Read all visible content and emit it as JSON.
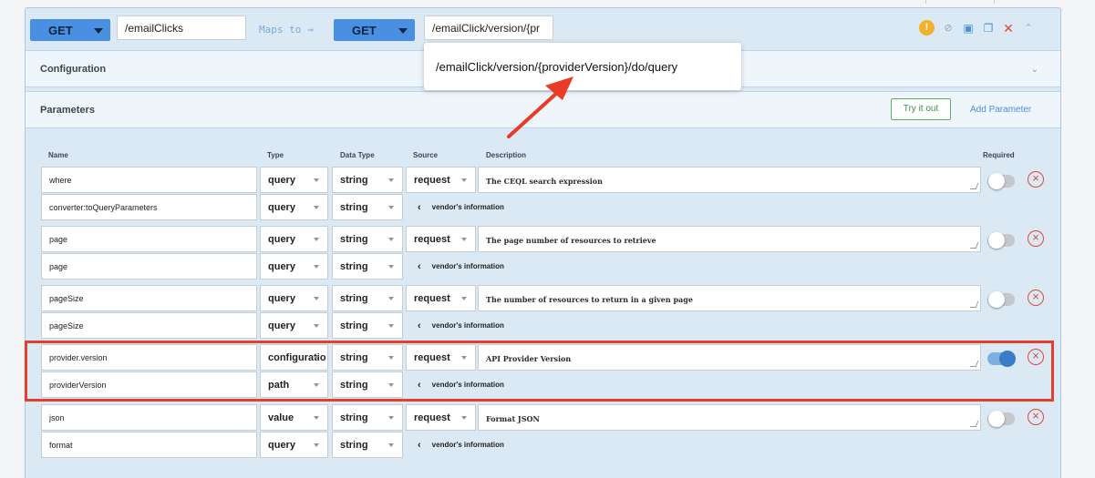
{
  "top_bar": {
    "left_method": "GET",
    "left_path": "/emailClicks",
    "maps_to_label": "Maps to →",
    "right_method": "GET",
    "right_path": "/emailClick/version/{pr"
  },
  "autocomplete": {
    "suggestion": "/emailClick/version/{providerVersion}/do/query"
  },
  "sections": {
    "configuration_title": "Configuration",
    "parameters_title": "Parameters",
    "try_it_out": "Try it out",
    "add_parameter": "Add Parameter"
  },
  "columns": {
    "name": "Name",
    "type": "Type",
    "data_type": "Data Type",
    "source": "Source",
    "description": "Description",
    "required": "Required"
  },
  "vendor_label": "vendor's information",
  "params": [
    {
      "name": "where",
      "type": "query",
      "data_type": "string",
      "source": "request",
      "description": "The CEQL search expression",
      "required": false,
      "vendor_name": "converter:toQueryParameters",
      "vendor_type": "query",
      "vendor_data_type": "string"
    },
    {
      "name": "page",
      "type": "query",
      "data_type": "string",
      "source": "request",
      "description": "The page number of resources to retrieve",
      "required": false,
      "vendor_name": "page",
      "vendor_type": "query",
      "vendor_data_type": "string"
    },
    {
      "name": "pageSize",
      "type": "query",
      "data_type": "string",
      "source": "request",
      "description": "The number of resources to return in a given page",
      "required": false,
      "vendor_name": "pageSize",
      "vendor_type": "query",
      "vendor_data_type": "string"
    },
    {
      "name": "provider.version",
      "type": "configuratio",
      "data_type": "string",
      "source": "request",
      "description": "API Provider Version",
      "required": true,
      "vendor_name": "providerVersion",
      "vendor_type": "path",
      "vendor_data_type": "string"
    },
    {
      "name": "json",
      "type": "value",
      "data_type": "string",
      "source": "request",
      "description": "Format JSON",
      "required": false,
      "vendor_name": "format",
      "vendor_type": "query",
      "vendor_data_type": "string"
    }
  ],
  "colors": {
    "accent": "#4a90e2",
    "highlight": "#e2402d",
    "warning": "#f2b12c",
    "remove": "#e0483c"
  },
  "icons": {
    "warning": "warning-icon",
    "disable": "disable-icon",
    "save": "save-icon",
    "copy": "copy-icon",
    "delete": "close-icon",
    "collapse": "chevron-up-icon"
  }
}
